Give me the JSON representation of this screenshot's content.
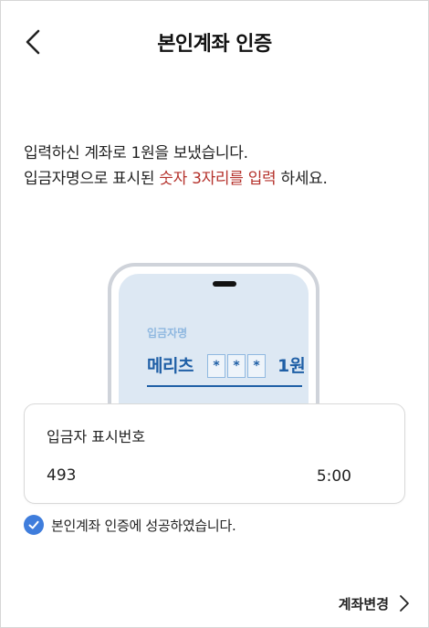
{
  "header": {
    "title": "본인계좌 인증",
    "back_icon": "chevron-left-icon"
  },
  "instructions": {
    "line1": "입력하신 계좌로 1원을 보냈습니다.",
    "line2_prefix": "입금자명으로 표시된 ",
    "line2_highlight": "숫자 3자리를 입력",
    "line2_suffix": " 하세요."
  },
  "illustration": {
    "label": "입금자명",
    "name": "메리츠",
    "masked_digits": [
      "*",
      "*",
      "*"
    ],
    "amount": "1원"
  },
  "depositor_card": {
    "label": "입금자 표시번호",
    "code": "493",
    "timer": "5:00"
  },
  "status": {
    "message": "본인계좌 인증에 성공하였습니다.",
    "icon": "check-circle-icon"
  },
  "footer": {
    "change_account_label": "계좌변경",
    "icon": "chevron-right-icon"
  },
  "colors": {
    "accent": "#b5322c",
    "brand_blue": "#1f5fa6",
    "check_blue": "#3f7ddc"
  }
}
